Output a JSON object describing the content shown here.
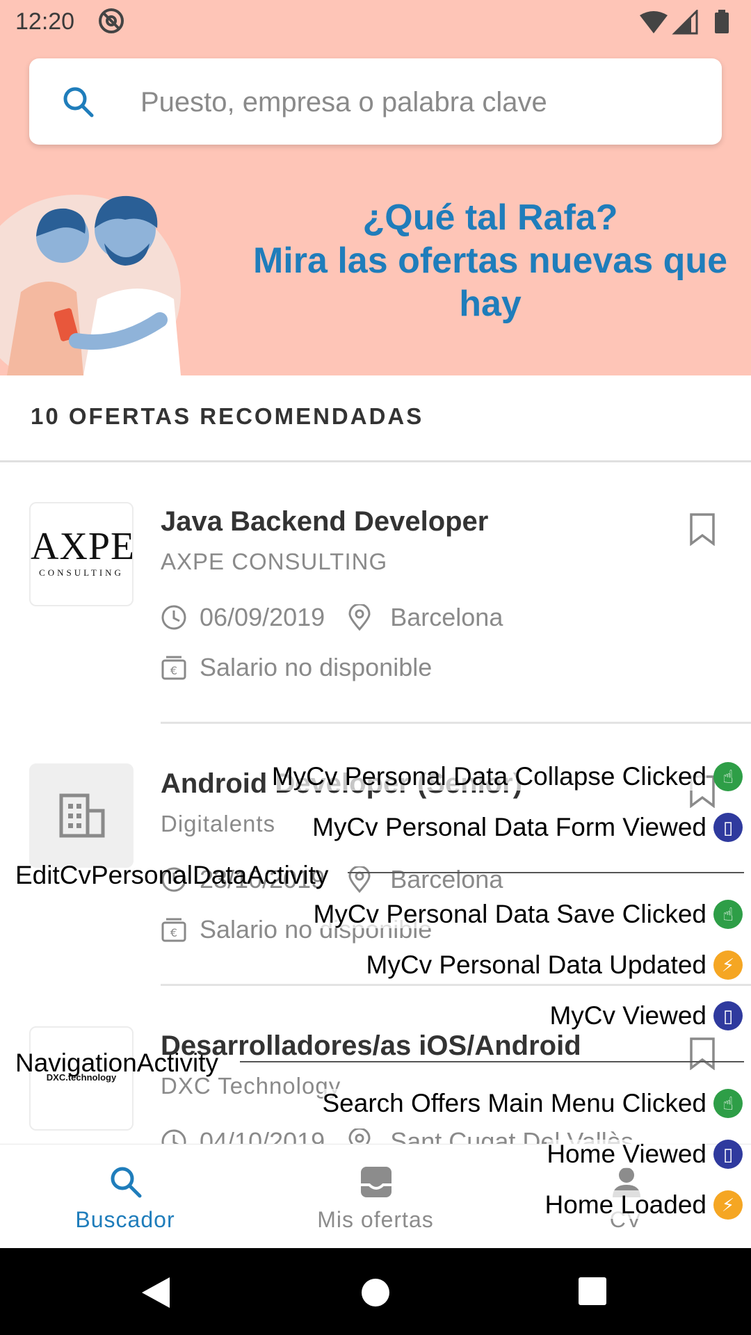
{
  "status_bar": {
    "time": "12:20"
  },
  "search": {
    "placeholder": "Puesto, empresa o palabra clave"
  },
  "greeting": {
    "line1": "¿Qué tal Rafa?",
    "line2": "Mira las ofertas nuevas que hay"
  },
  "section": {
    "title": "10 OFERTAS RECOMENDADAS"
  },
  "offers": [
    {
      "title": "Java Backend Developer",
      "company": "AXPE CONSULTING",
      "date": "06/09/2019",
      "location": "Barcelona",
      "salary": "Salario no disponible",
      "logo_text": "AXPE",
      "logo_sub": "CONSULTING"
    },
    {
      "title": "Android Developer (Senior)",
      "company": "Digitalents",
      "date": "23/10/2019",
      "location": "Barcelona",
      "salary": "Salario no disponible"
    },
    {
      "title": "Desarrolladores/as iOS/Android",
      "company": "DXC Technology",
      "date": "04/10/2019",
      "location": "Sant Cugat Del Vallès",
      "logo_text": "DXC.technology"
    }
  ],
  "bottom_nav": [
    {
      "label": "Buscador",
      "icon": "search-icon",
      "active": true
    },
    {
      "label": "Mis ofertas",
      "icon": "inbox-icon",
      "active": false
    },
    {
      "label": "CV",
      "icon": "person-icon",
      "active": false
    }
  ],
  "overlay": {
    "activities": [
      "EditCvPersonalDataActivity",
      "NavigationActivity"
    ],
    "events": [
      {
        "text": "MyCv Personal Data Collapse Clicked",
        "kind": "click"
      },
      {
        "text": "MyCv Personal Data Form Viewed",
        "kind": "view"
      },
      {
        "text": "MyCv Personal Data Save Clicked",
        "kind": "click"
      },
      {
        "text": "MyCv Personal Data Updated",
        "kind": "event"
      },
      {
        "text": "MyCv Viewed",
        "kind": "view"
      },
      {
        "text": "Search Offers Main Menu Clicked",
        "kind": "click"
      },
      {
        "text": "Home Viewed",
        "kind": "view"
      },
      {
        "text": "Home Loaded",
        "kind": "event"
      }
    ]
  },
  "colors": {
    "hero_bg": "#fec5b7",
    "accent": "#1f7dbb",
    "click_badge": "#2e9e47",
    "view_badge": "#2f3a9e",
    "event_badge": "#f5a623"
  }
}
